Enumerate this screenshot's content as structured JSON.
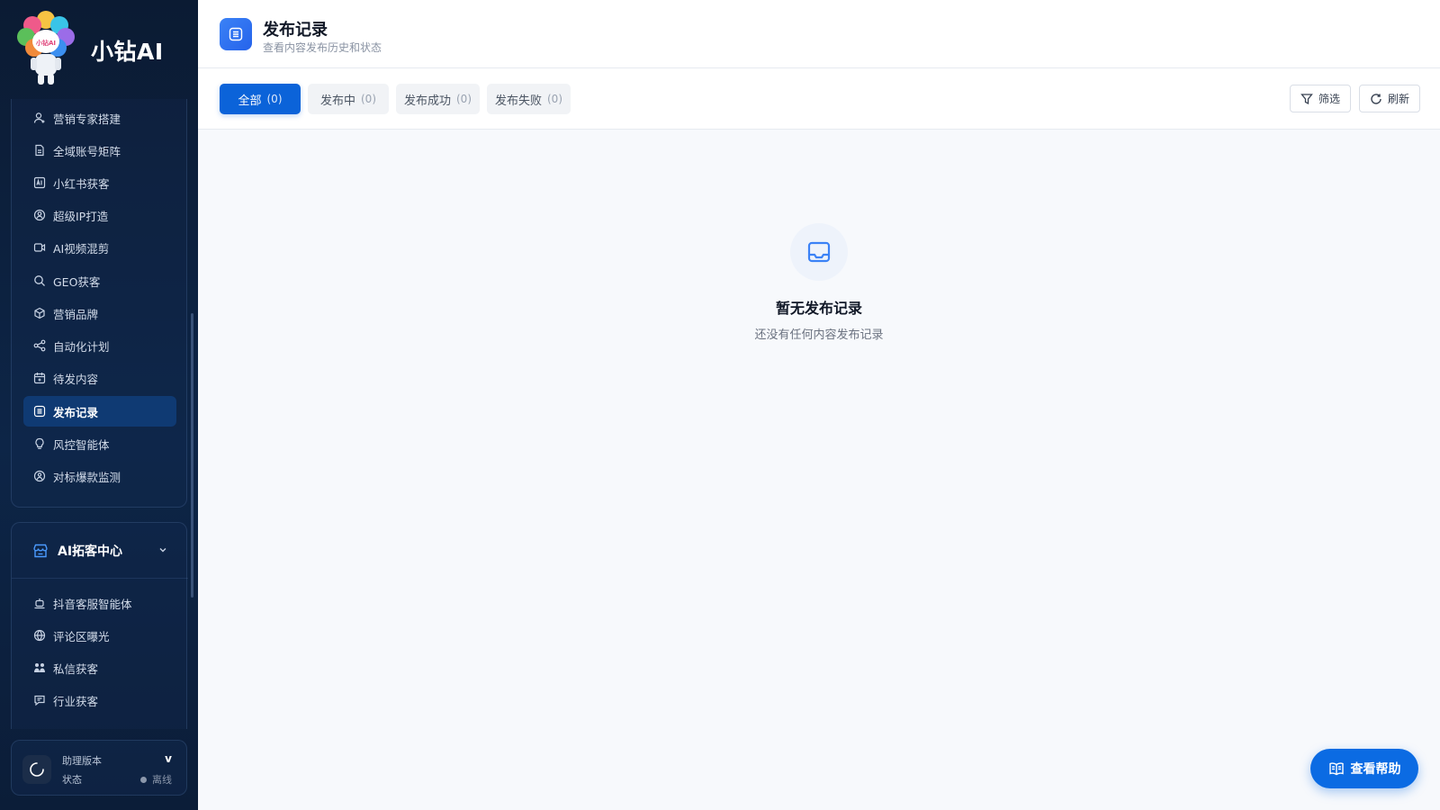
{
  "brand": {
    "name": "小钻AI",
    "logo_text": "小钻AI"
  },
  "sidebar": {
    "items": [
      {
        "label": "营销专家搭建",
        "icon": "user-plus-icon"
      },
      {
        "label": "全域账号矩阵",
        "icon": "document-icon"
      },
      {
        "label": "小红书获客",
        "icon": "ai-badge-icon"
      },
      {
        "label": "超级IP打造",
        "icon": "ip-user-icon"
      },
      {
        "label": "AI视频混剪",
        "icon": "video-icon"
      },
      {
        "label": "GEO获客",
        "icon": "search-icon"
      },
      {
        "label": "营销品牌",
        "icon": "cube-icon"
      },
      {
        "label": "自动化计划",
        "icon": "share-nodes-icon"
      },
      {
        "label": "待发内容",
        "icon": "calendar-icon"
      },
      {
        "label": "发布记录",
        "icon": "list-icon",
        "active": true
      },
      {
        "label": "风控智能体",
        "icon": "lightbulb-icon"
      },
      {
        "label": "对标爆款监测",
        "icon": "radar-icon"
      }
    ],
    "group": {
      "title": "AI拓客中心",
      "icon": "store-icon",
      "items": [
        {
          "label": "抖音客服智能体",
          "icon": "robot-icon"
        },
        {
          "label": "评论区曝光",
          "icon": "globe-icon"
        },
        {
          "label": "私信获客",
          "icon": "handshake-icon"
        },
        {
          "label": "行业获客",
          "icon": "chat-icon"
        }
      ]
    },
    "version": {
      "label": "助理版本",
      "value": "v",
      "status_label": "状态",
      "status_value": "离线",
      "status_color": "#8b97ab"
    }
  },
  "header": {
    "title": "发布记录",
    "subtitle": "查看内容发布历史和状态",
    "icon": "list-icon"
  },
  "tabs": [
    {
      "label": "全部",
      "count": "(0)",
      "active": true
    },
    {
      "label": "发布中",
      "count": "(0)"
    },
    {
      "label": "发布成功",
      "count": "(0)"
    },
    {
      "label": "发布失败",
      "count": "(0)"
    }
  ],
  "actions": {
    "filter_label": "筛选",
    "refresh_label": "刷新"
  },
  "empty": {
    "title": "暂无发布记录",
    "description": "还没有任何内容发布记录",
    "icon": "inbox-icon"
  },
  "help": {
    "label": "查看帮助",
    "icon": "book-icon"
  },
  "colors": {
    "accent": "#0b63d9",
    "sidebar_bg": "#0b1b33",
    "sidebar_active": "#0f3a73"
  }
}
